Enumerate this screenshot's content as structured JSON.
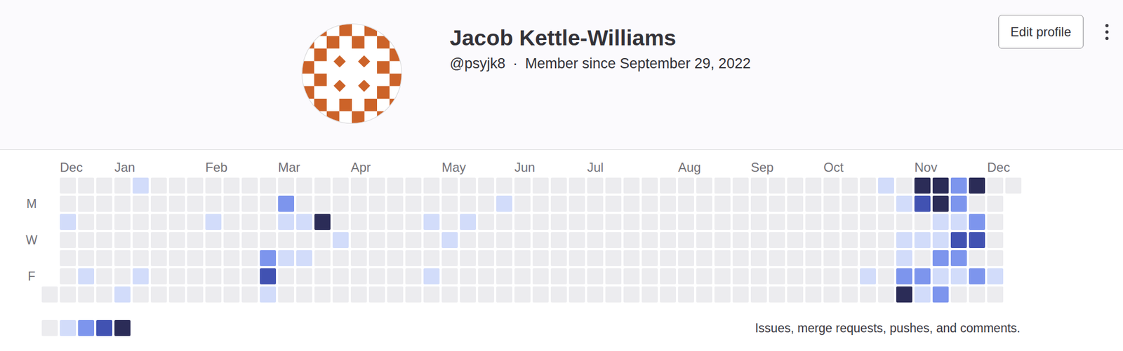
{
  "profile": {
    "name": "Jacob Kettle-Williams",
    "username": "@psyjk8",
    "separator": "·",
    "member_since": "Member since September 29, 2022"
  },
  "actions": {
    "edit_button": "Edit profile"
  },
  "calendar": {
    "months": [
      {
        "label": "Dec",
        "week": 1
      },
      {
        "label": "Jan",
        "week": 4
      },
      {
        "label": "Feb",
        "week": 9
      },
      {
        "label": "Mar",
        "week": 13
      },
      {
        "label": "Apr",
        "week": 17
      },
      {
        "label": "May",
        "week": 22
      },
      {
        "label": "Jun",
        "week": 26
      },
      {
        "label": "Jul",
        "week": 30
      },
      {
        "label": "Aug",
        "week": 35
      },
      {
        "label": "Sep",
        "week": 39
      },
      {
        "label": "Oct",
        "week": 43
      },
      {
        "label": "Nov",
        "week": 48
      },
      {
        "label": "Dec",
        "week": 52
      }
    ],
    "day_labels": [
      "",
      "M",
      "",
      "W",
      "",
      "F",
      ""
    ],
    "weeks": [
      [
        null,
        null,
        null,
        null,
        null,
        null,
        0
      ],
      [
        0,
        0,
        0.25,
        0,
        0,
        0,
        0
      ],
      [
        0,
        0,
        0,
        0,
        0,
        0.25,
        0
      ],
      [
        0,
        0,
        0,
        0,
        0,
        0,
        0
      ],
      [
        0,
        0,
        0,
        0,
        0,
        0,
        0.25
      ],
      [
        0.25,
        0,
        0,
        0,
        0,
        0.25,
        0
      ],
      [
        0,
        0,
        0,
        0,
        0,
        0,
        0
      ],
      [
        0,
        0,
        0,
        0,
        0,
        0,
        0
      ],
      [
        0,
        0,
        0,
        0,
        0,
        0,
        0
      ],
      [
        0,
        0,
        0.25,
        0,
        0,
        0,
        0
      ],
      [
        0,
        0,
        0,
        0,
        0,
        0,
        0
      ],
      [
        0,
        0,
        0,
        0,
        0,
        0,
        0
      ],
      [
        0,
        0,
        0,
        0,
        0.5,
        0.75,
        0.25
      ],
      [
        0,
        0.5,
        0.25,
        0,
        0.25,
        0,
        0
      ],
      [
        0,
        0,
        0.25,
        0,
        0.25,
        0,
        0
      ],
      [
        0,
        0,
        1,
        0,
        0,
        0,
        0
      ],
      [
        0,
        0,
        0,
        0.25,
        0,
        0,
        0
      ],
      [
        0,
        0,
        0,
        0,
        0,
        0,
        0
      ],
      [
        0,
        0,
        0,
        0,
        0,
        0,
        0
      ],
      [
        0,
        0,
        0,
        0,
        0,
        0,
        0
      ],
      [
        0,
        0,
        0,
        0,
        0,
        0,
        0
      ],
      [
        0,
        0,
        0.25,
        0,
        0,
        0.25,
        0
      ],
      [
        0,
        0,
        0,
        0.25,
        0,
        0,
        0
      ],
      [
        0,
        0,
        0.25,
        0,
        0,
        0,
        0
      ],
      [
        0,
        0,
        0,
        0,
        0,
        0,
        0
      ],
      [
        0,
        0.25,
        0,
        0,
        0,
        0,
        0
      ],
      [
        0,
        0,
        0,
        0,
        0,
        0,
        0
      ],
      [
        0,
        0,
        0,
        0,
        0,
        0,
        0
      ],
      [
        0,
        0,
        0,
        0,
        0,
        0,
        0
      ],
      [
        0,
        0,
        0,
        0,
        0,
        0,
        0
      ],
      [
        0,
        0,
        0,
        0,
        0,
        0,
        0
      ],
      [
        0,
        0,
        0,
        0,
        0,
        0,
        0
      ],
      [
        0,
        0,
        0,
        0,
        0,
        0,
        0
      ],
      [
        0,
        0,
        0,
        0,
        0,
        0,
        0
      ],
      [
        0,
        0,
        0,
        0,
        0,
        0,
        0
      ],
      [
        0,
        0,
        0,
        0,
        0,
        0,
        0
      ],
      [
        0,
        0,
        0,
        0,
        0,
        0,
        0
      ],
      [
        0,
        0,
        0,
        0,
        0,
        0,
        0
      ],
      [
        0,
        0,
        0,
        0,
        0,
        0,
        0
      ],
      [
        0,
        0,
        0,
        0,
        0,
        0,
        0
      ],
      [
        0,
        0,
        0,
        0,
        0,
        0,
        0
      ],
      [
        0,
        0,
        0,
        0,
        0,
        0,
        0
      ],
      [
        0,
        0,
        0,
        0,
        0,
        0,
        0
      ],
      [
        0,
        0,
        0,
        0,
        0,
        0,
        0
      ],
      [
        0,
        0,
        0,
        0,
        0,
        0,
        0
      ],
      [
        0,
        0,
        0,
        0,
        0,
        0.25,
        0
      ],
      [
        0.25,
        0,
        0,
        0,
        0,
        0,
        0
      ],
      [
        0,
        0.25,
        0,
        0.25,
        0.25,
        0.5,
        1
      ],
      [
        1,
        0.75,
        0,
        0.25,
        0,
        0.5,
        0.25
      ],
      [
        1,
        1,
        0.25,
        0.25,
        0.5,
        0.25,
        0.5
      ],
      [
        0.5,
        0.5,
        0.25,
        0.75,
        0.5,
        0.25,
        0
      ],
      [
        1,
        0,
        0.5,
        0.75,
        0,
        0.5,
        0
      ],
      [
        0,
        0,
        0,
        0,
        0,
        0.25,
        0
      ],
      [
        0,
        null,
        null,
        null,
        null,
        null,
        null
      ]
    ],
    "legend": {
      "levels": [
        0,
        0.25,
        0.5,
        0.75,
        1
      ],
      "caption": "Issues, merge requests, pushes, and comments."
    }
  }
}
